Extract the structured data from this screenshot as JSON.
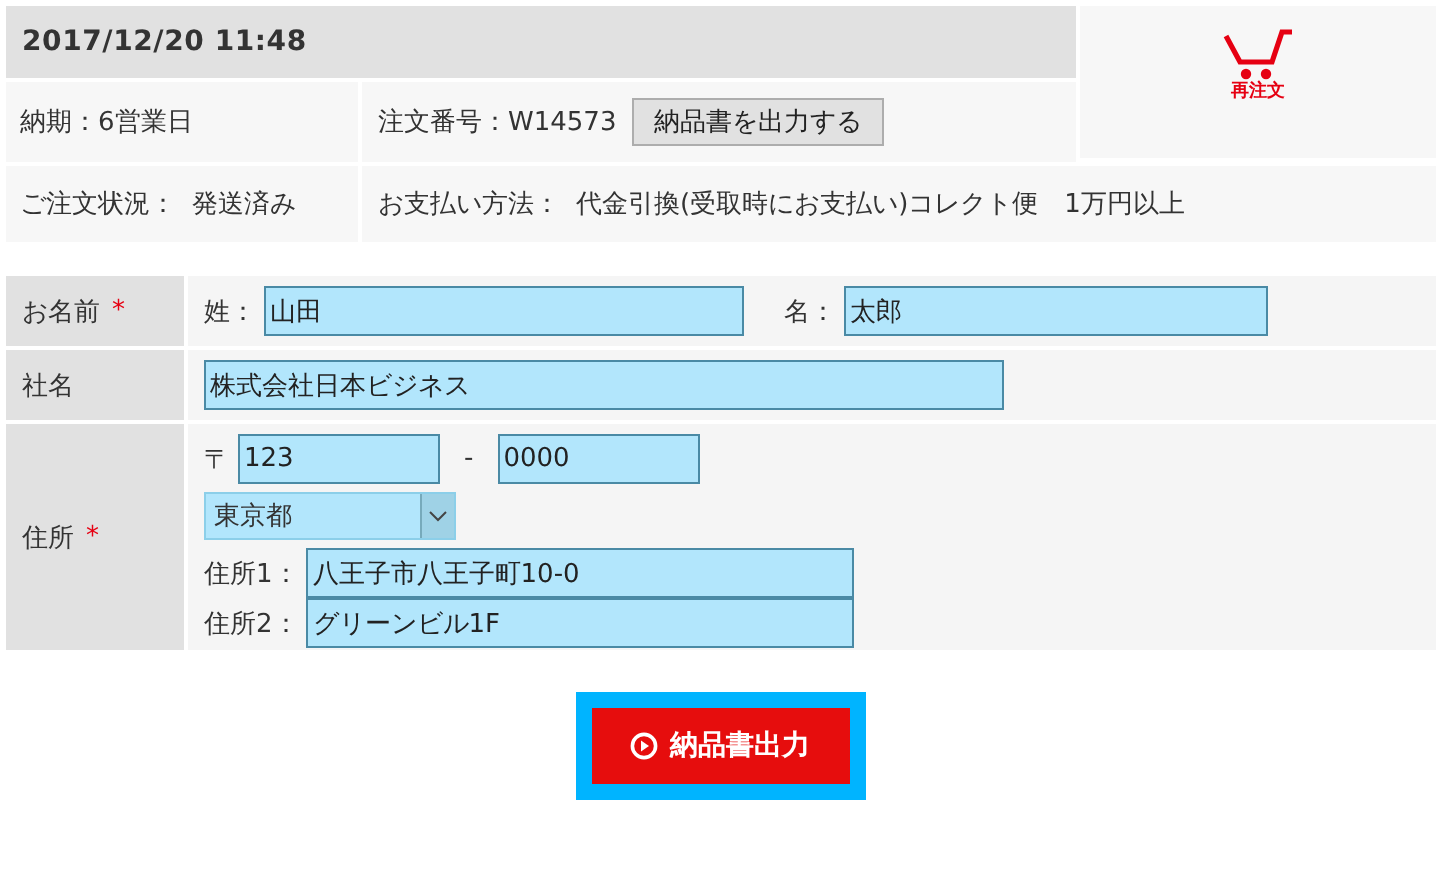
{
  "order": {
    "datetime": "2017/12/20 11:48",
    "reorder_label": "再注文",
    "delivery": "納期：6営業日",
    "order_number": "注文番号：W14573",
    "invoice_button": "納品書を出力する",
    "status_label": "ご注文状況：",
    "status": "発送済み",
    "payment_label": "お支払い方法：",
    "payment": "代金引換(受取時にお支払い)コレクト便　1万円以上"
  },
  "form": {
    "name": {
      "label": "お名前",
      "required": true,
      "last_label": "姓：",
      "last_value": "山田",
      "first_label": "名：",
      "first_value": "太郎"
    },
    "company": {
      "label": "社名",
      "required": false,
      "value": "株式会社日本ビジネス"
    },
    "address": {
      "label": "住所",
      "required": true,
      "postal_mark": "〒",
      "zip1": "123",
      "zip_sep": "-",
      "zip2": "0000",
      "prefecture": "東京都",
      "line1_label": "住所1：",
      "line1": "八王子市八王子町10-0",
      "line2_label": "住所2：",
      "line2": "グリーンビル1F"
    },
    "required_mark": "*"
  },
  "submit_button": "納品書出力"
}
